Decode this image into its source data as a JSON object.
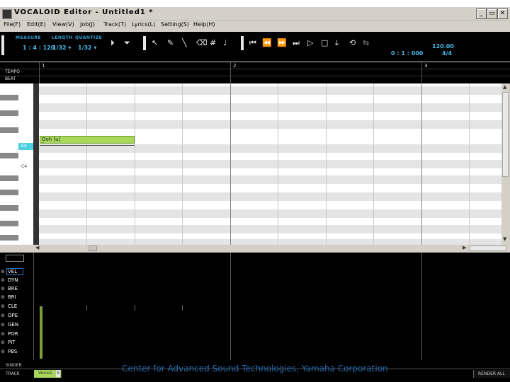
{
  "window": {
    "title": "VOCALOID Editor - Untitled1 *",
    "buttons": [
      "_",
      "▭",
      "✕"
    ]
  },
  "menu": [
    {
      "label": "File(F)"
    },
    {
      "label": "Edit(E)"
    },
    {
      "label": "View(V)"
    },
    {
      "label": "Job(J)"
    },
    {
      "label": "Track(T)"
    },
    {
      "label": "Lyrics(L)"
    },
    {
      "label": "Setting(S)"
    },
    {
      "label": "Help(H)"
    }
  ],
  "toolbar": {
    "measure_label": "MEASURE",
    "measure_value": "1 : 4 : 120",
    "length_label": "LENGTH",
    "length_value": "1/32 ▾",
    "quantize_label": "QUANTIZE",
    "quantize_value": "1/32 ▾",
    "time_value": "0 : 1 : 000",
    "tempo_value": "120.00",
    "beat_value": "4/4"
  },
  "ruler": {
    "tempo_label": "TEMPO",
    "beat_label": "BEAT",
    "measures": [
      "1",
      "2",
      "3"
    ]
  },
  "piano_roll": {
    "key_label_1": "E4",
    "key_label_2": "C4",
    "note_lyric": "Ooh [u]"
  },
  "controls": [
    "VEL",
    "DYN",
    "BRE",
    "BRI",
    "CLE",
    "OPE",
    "GEN",
    "POR",
    "PIT",
    "PBS"
  ],
  "bottom": {
    "singer_label": "SINGER",
    "track_label": "TRACK",
    "track_name": "Voice1",
    "track_badge": "S",
    "render_label": "RENDER ALL"
  },
  "watermark": "Center for Advanced Sound Technologies, Yamaha Corporation"
}
